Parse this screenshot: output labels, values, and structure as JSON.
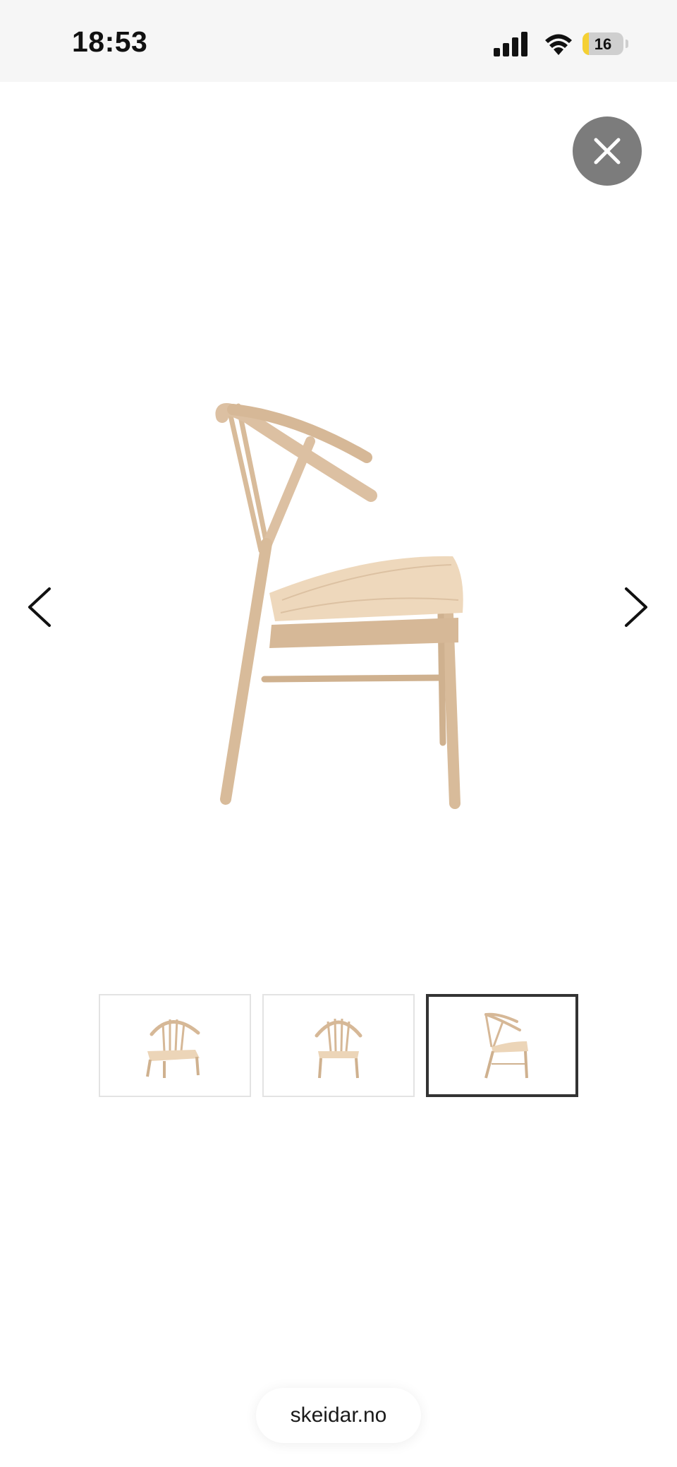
{
  "status_bar": {
    "time": "18:53",
    "battery_level": "16",
    "battery_fraction": 0.16,
    "battery_color": "#f5d033",
    "icons": [
      "cellular-signal-icon",
      "wifi-icon",
      "battery-icon"
    ]
  },
  "viewer": {
    "close_icon": "close-icon",
    "prev_icon": "chevron-left-icon",
    "next_icon": "chevron-right-icon",
    "selected_thumbnail": 3,
    "thumbnail_count": 3,
    "colors": {
      "wood": "#dcc0a2",
      "seat": "#eed8bc",
      "close_bg": "#7c7c7c",
      "selected_border": "#333333"
    }
  },
  "browser": {
    "domain": "skeidar.no"
  }
}
